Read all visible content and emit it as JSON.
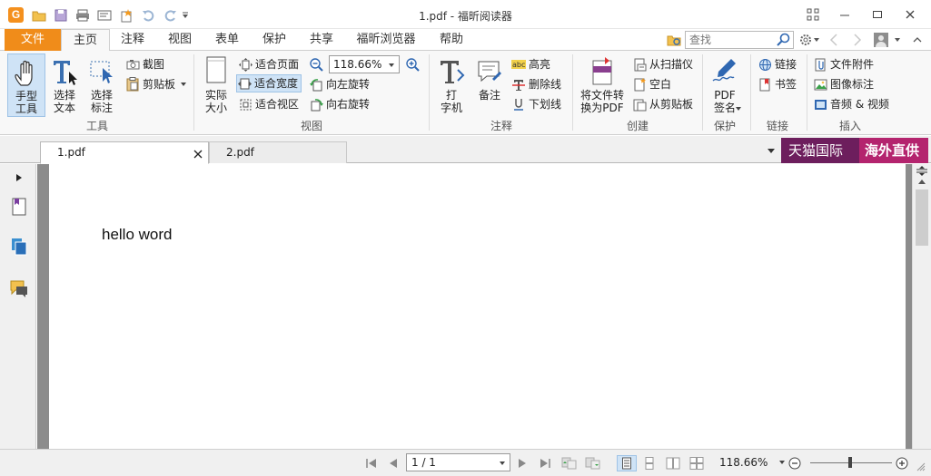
{
  "window": {
    "title": "1.pdf - 福昕阅读器",
    "logo_letter": "G"
  },
  "ribbon_tabs": [
    {
      "label": "文件"
    },
    {
      "label": "主页"
    },
    {
      "label": "注释"
    },
    {
      "label": "视图"
    },
    {
      "label": "表单"
    },
    {
      "label": "保护"
    },
    {
      "label": "共享"
    },
    {
      "label": "福昕浏览器"
    },
    {
      "label": "帮助"
    }
  ],
  "search": {
    "placeholder": "查找"
  },
  "ribbon": {
    "groups": {
      "tools": "工具",
      "view": "视图",
      "comment": "注释",
      "create": "创建",
      "protect": "保护",
      "link": "链接",
      "insert": "插入"
    },
    "hand_tool": "手型\n工具",
    "select_text": "选择\n文本",
    "select_annot": "选择\n标注",
    "snapshot": "截图",
    "clipboard": "剪贴板",
    "actual_size": "实际\n大小",
    "fit_page": "适合页面",
    "fit_width": "适合宽度",
    "fit_visible": "适合视区",
    "zoom_value": "118.66%",
    "rotate_left": "向左旋转",
    "rotate_right": "向右旋转",
    "typewriter": "打\n字机",
    "note": "备注",
    "highlight": "高亮",
    "strikeout": "删除线",
    "underline": "下划线",
    "convert_pdf": "将文件转\n换为PDF",
    "from_scanner": "从扫描仪",
    "blank": "空白",
    "from_clipboard": "从剪贴板",
    "pdf_sign": "PDF\n签名",
    "link": "链接",
    "bookmark": "书签",
    "file_attachment": "文件附件",
    "image_annotation": "图像标注",
    "audio_video": "音频 & 视频"
  },
  "doc_tabs": [
    {
      "label": "1.pdf",
      "active": true
    },
    {
      "label": "2.pdf",
      "active": false
    }
  ],
  "ad_banner": {
    "left": "天猫国际",
    "right": "海外直供"
  },
  "document": {
    "text": "hello word"
  },
  "status": {
    "page": "1 / 1",
    "zoom": "118.66%"
  },
  "colors": {
    "accent": "#f08c1a",
    "selected": "#cfe3f6",
    "ad_dark": "#6d1e5d",
    "ad_light": "#b4246e"
  }
}
